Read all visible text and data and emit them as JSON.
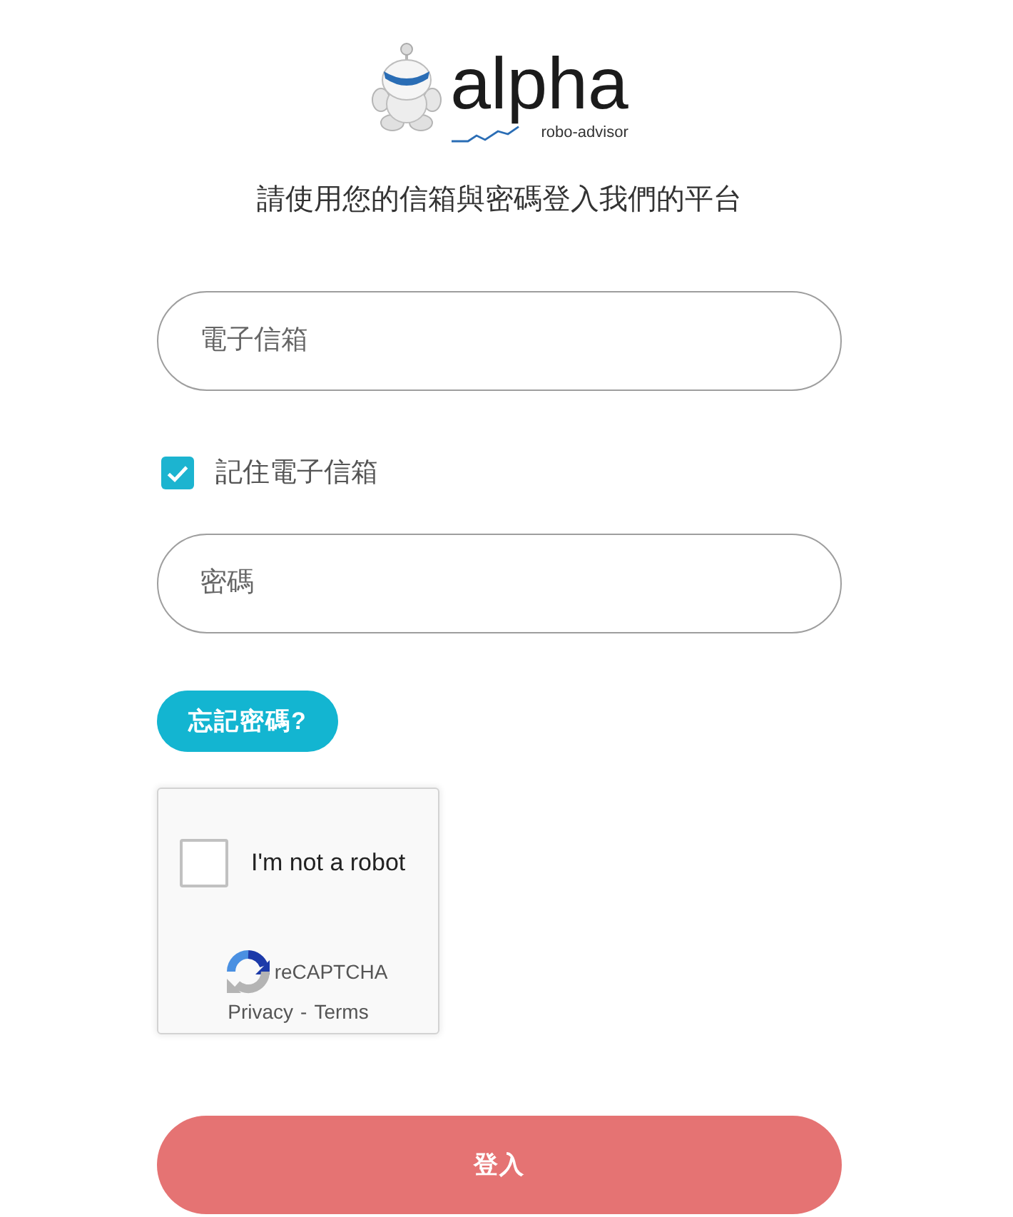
{
  "logo": {
    "wordmark": "alpha",
    "tagline": "robo-advisor"
  },
  "heading": "請使用您的信箱與密碼登入我們的平台",
  "email_field": {
    "placeholder": "電子信箱"
  },
  "remember_email": {
    "label": "記住電子信箱",
    "checked": true
  },
  "password_field": {
    "placeholder": "密碼"
  },
  "forgot_password_button": {
    "label": "忘記密碼?"
  },
  "recaptcha": {
    "checked": false,
    "label": "I'm not a robot",
    "brand": "reCAPTCHA",
    "privacy_link": "Privacy",
    "separator": "-",
    "terms_link": "Terms"
  },
  "login_button": {
    "label": "登入"
  }
}
